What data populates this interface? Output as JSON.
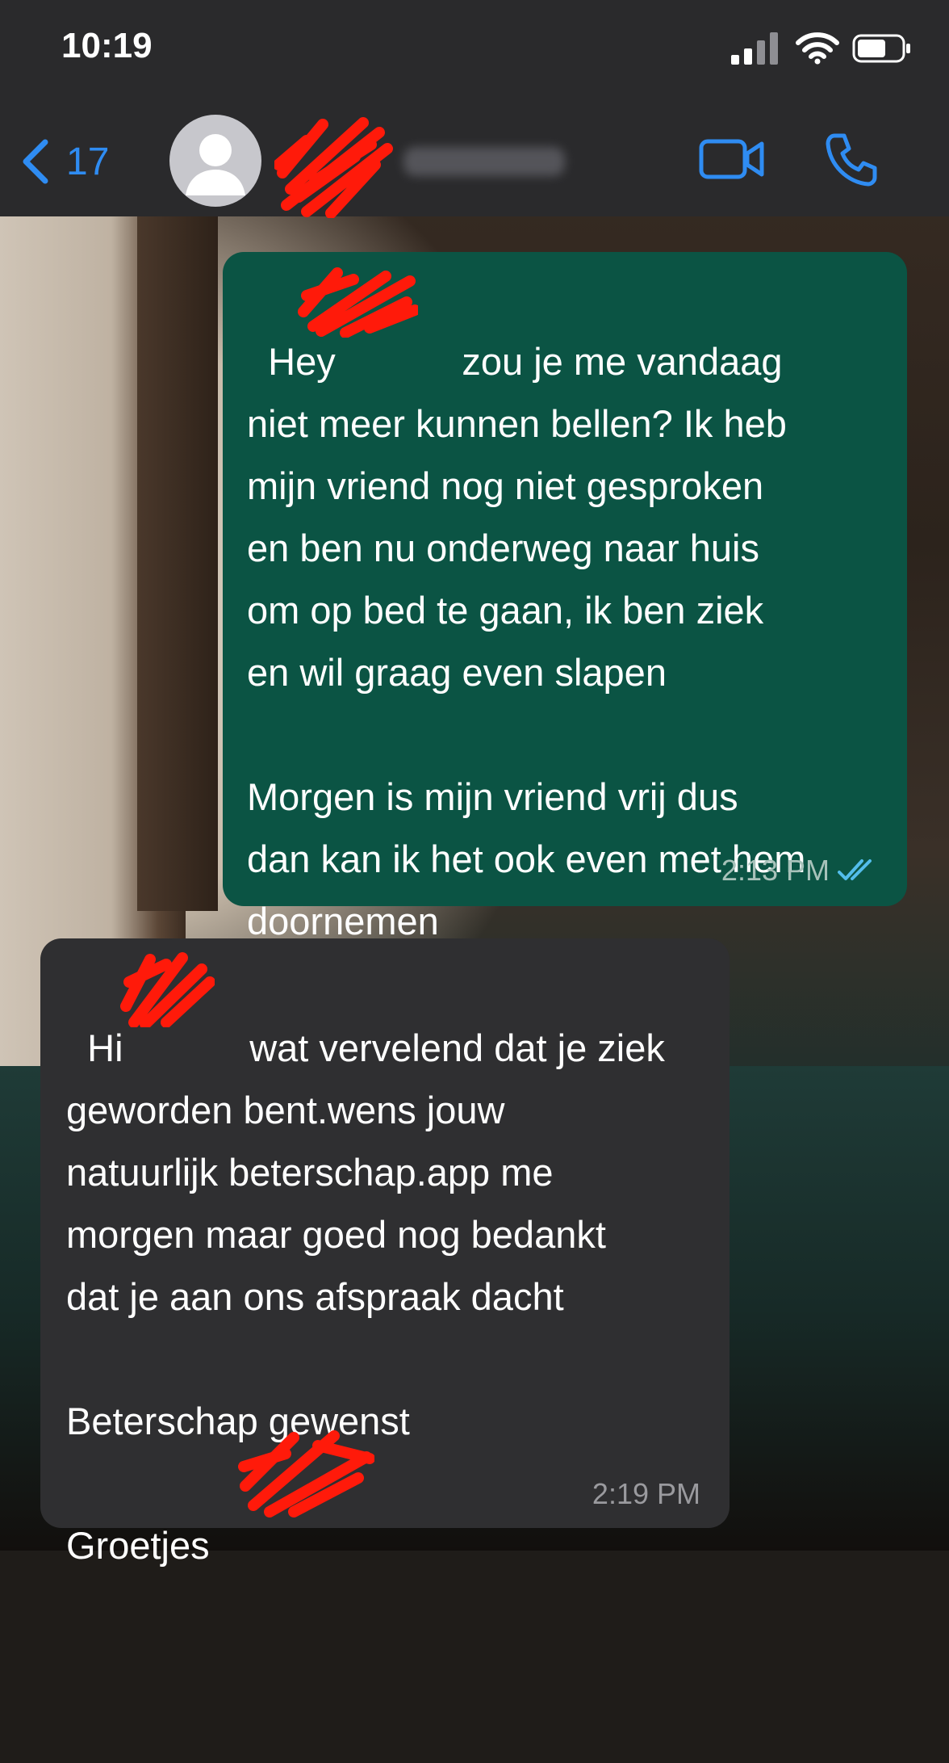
{
  "status_bar": {
    "time": "10:19"
  },
  "header": {
    "back_count": "17",
    "icons": [
      "chevron-left-icon",
      "avatar-icon",
      "video-icon",
      "phone-icon"
    ],
    "accent_color": "#2f8cf2"
  },
  "messages": [
    {
      "direction": "outgoing",
      "text": "Hey            zou je me vandaag\nniet meer kunnen bellen? Ik heb\nmijn vriend nog niet gesproken\nen ben nu onderweg naar huis\nom op bed te gaan, ik ben ziek\nen wil graag even slapen\n\nMorgen is mijn vriend vrij dus\ndan kan ik het ook even met hem\ndoornemen",
      "time": "2:13 PM",
      "read_ticks": "double-check-icon",
      "bubble_color": "#0b5444"
    },
    {
      "direction": "incoming",
      "text": "Hi            wat vervelend dat je ziek\ngeworden bent.wens jouw\nnatuurlijk beterschap.app me\nmorgen maar goed nog bedankt\ndat je aan ons afspraak dacht\n\nBeterschap gewenst\n\nGroetjes",
      "time": "2:19 PM",
      "bubble_color": "#2f2f31"
    }
  ]
}
